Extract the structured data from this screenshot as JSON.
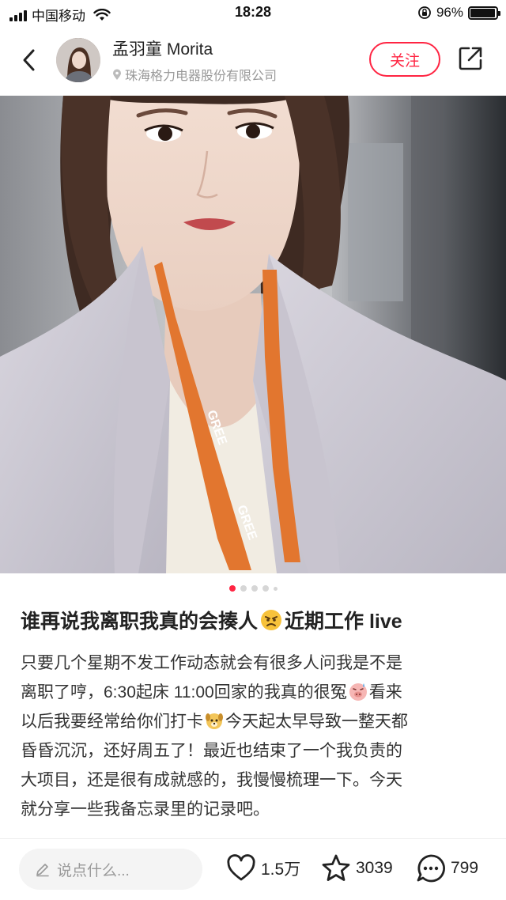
{
  "status_bar": {
    "carrier": "中国移动",
    "time": "18:28",
    "battery_percent": "96%",
    "battery_level": 0.96
  },
  "header": {
    "user_name": "孟羽童 Morita",
    "location": "珠海格力电器股份有限公司",
    "follow_label": "关注"
  },
  "carousel": {
    "total": 5,
    "active_index": 0
  },
  "post": {
    "title_part1": "谁再说我离职我真的会揍人",
    "title_part2": "近期工作 live",
    "body": [
      {
        "text1": "只要几个星期不发工作动态就会有很多人问我是不是",
        "emoji": "",
        "text2": ""
      },
      {
        "text1": "离职了哼，6:30起床 11:00回家的我真的很冤",
        "emoji": "pig-sweat-emoji",
        "text2": "看来"
      },
      {
        "text1": "以后我要经常给你们打卡",
        "emoji": "dog-emoji",
        "text2": "今天起太早导致一整天都"
      },
      {
        "text1": "昏昏沉沉，还好周五了！最近也结束了一个我负责的",
        "emoji": "",
        "text2": ""
      },
      {
        "text1": "大项目，还是很有成就感的，我慢慢梳理一下。今天",
        "emoji": "",
        "text2": ""
      },
      {
        "text1": "就分享一些我备忘录里的记录吧。",
        "emoji": "",
        "text2": ""
      }
    ]
  },
  "bottom_bar": {
    "comment_placeholder": "说点什么...",
    "likes": "1.5万",
    "collects": "3039",
    "comments": "799"
  },
  "colors": {
    "accent": "#ff2442"
  }
}
